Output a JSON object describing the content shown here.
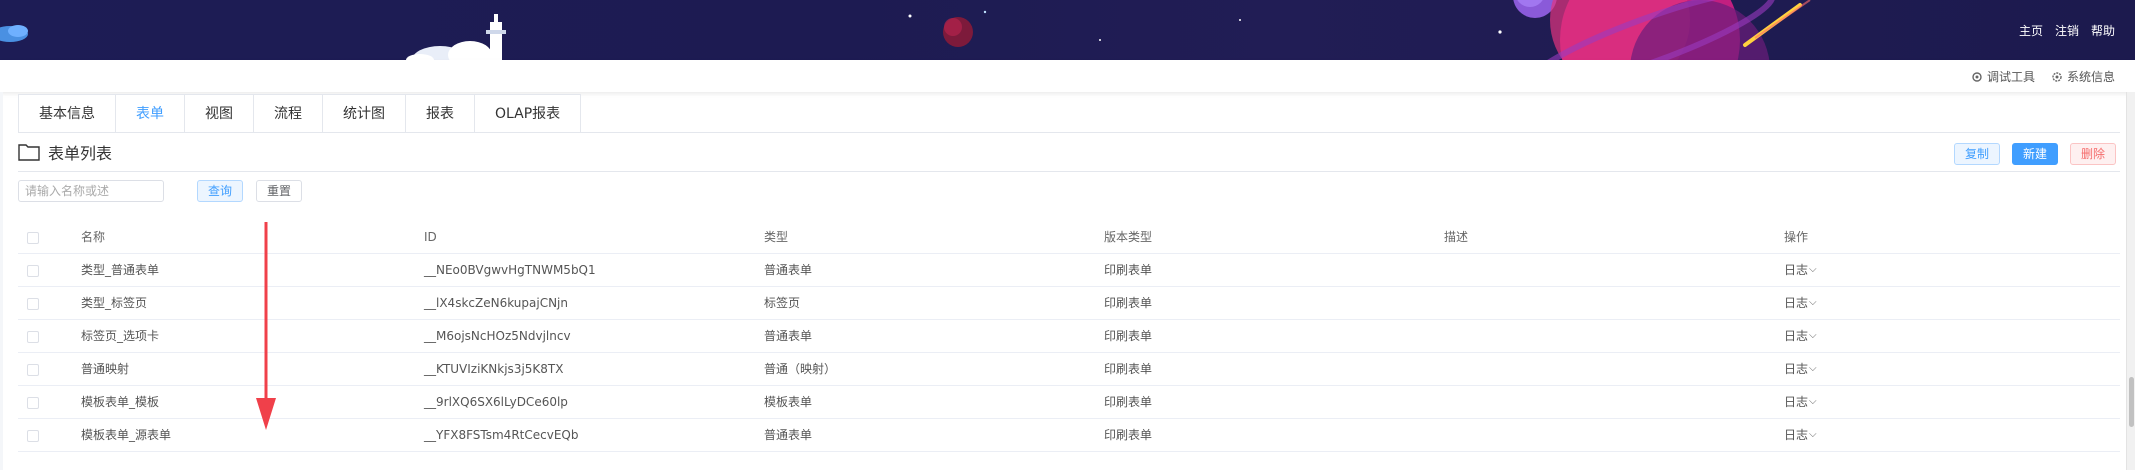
{
  "header": {
    "links": [
      "主页",
      "注销",
      "帮助"
    ]
  },
  "toolbar": {
    "debug_label": "调试工具",
    "sysinfo_label": "系统信息"
  },
  "tabs": [
    "基本信息",
    "表单",
    "视图",
    "流程",
    "统计图",
    "报表",
    "OLAP报表"
  ],
  "active_tab": "表单",
  "section": {
    "title": "表单列表",
    "copy_label": "复制",
    "new_label": "新建",
    "delete_label": "删除"
  },
  "search": {
    "placeholder": "请输入名称或述",
    "query_label": "查询",
    "reset_label": "重置"
  },
  "table": {
    "columns": [
      "名称",
      "ID",
      "类型",
      "版本类型",
      "描述",
      "操作"
    ],
    "rows": [
      {
        "name": "类型_普通表单",
        "id": "__NEo0BVgwvHgTNWM5bQ1",
        "type": "普通表单",
        "version": "印刷表单",
        "desc": "",
        "op": "日志"
      },
      {
        "name": "类型_标签页",
        "id": "__lX4skcZeN6kupajCNjn",
        "type": "标签页",
        "version": "印刷表单",
        "desc": "",
        "op": "日志"
      },
      {
        "name": "标签页_选项卡",
        "id": "__M6ojsNcHOz5Ndvjlncv",
        "type": "普通表单",
        "version": "印刷表单",
        "desc": "",
        "op": "日志"
      },
      {
        "name": "普通映射",
        "id": "__KTUVIziKNkjs3j5K8TX",
        "type": "普通（映射）",
        "version": "印刷表单",
        "desc": "",
        "op": "日志"
      },
      {
        "name": "模板表单_模板",
        "id": "__9rlXQ6SX6lLyDCe60lp",
        "type": "模板表单",
        "version": "印刷表单",
        "desc": "",
        "op": "日志"
      },
      {
        "name": "模板表单_源表单",
        "id": "__YFX8FSTsm4RtCecvEQb",
        "type": "普通表单",
        "version": "印刷表单",
        "desc": "",
        "op": "日志"
      }
    ]
  },
  "colors": {
    "accent": "#409eff",
    "danger": "#f56c6c",
    "banner": "#1d1c55",
    "annotation_arrow": "#f0404a"
  }
}
